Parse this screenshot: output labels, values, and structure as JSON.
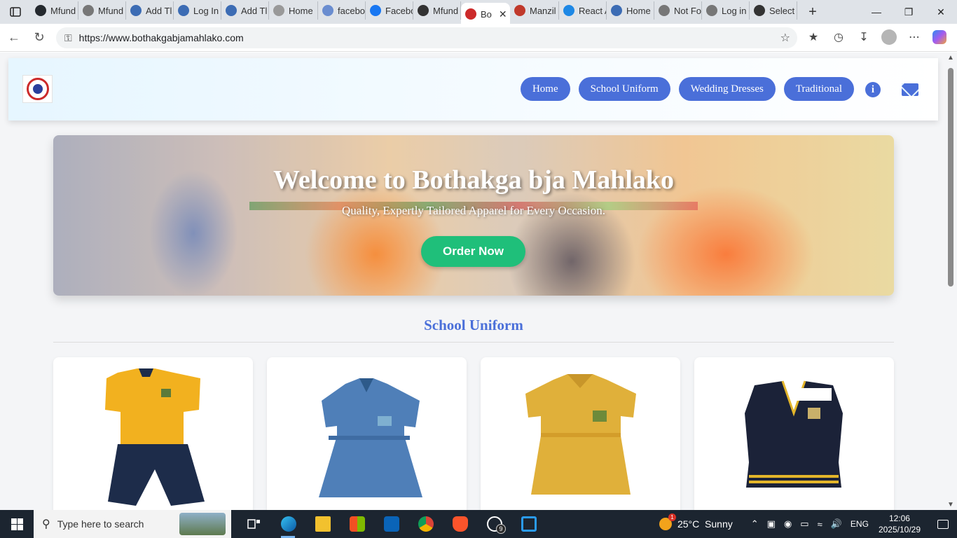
{
  "browser": {
    "tabs": [
      {
        "label": "Mfund",
        "icon": "github-icon",
        "color": "#24292e"
      },
      {
        "label": "Mfund",
        "icon": "globe-icon",
        "color": "#777777"
      },
      {
        "label": "Add Tl",
        "icon": "wordpress-icon",
        "color": "#3c6cb4"
      },
      {
        "label": "Log In",
        "icon": "wordpress-icon",
        "color": "#3c6cb4"
      },
      {
        "label": "Add Tl",
        "icon": "wordpress-icon",
        "color": "#3c6cb4"
      },
      {
        "label": "Home",
        "icon": "page-icon",
        "color": "#999999"
      },
      {
        "label": "facebo",
        "icon": "search-icon",
        "color": "#6a8dd0"
      },
      {
        "label": "Facebo",
        "icon": "facebook-icon",
        "color": "#1877f2"
      },
      {
        "label": "Mfund",
        "icon": "globe-icon",
        "color": "#333333"
      },
      {
        "label": "Bo",
        "icon": "site-logo-icon",
        "color": "#cc2a2a",
        "active": true
      },
      {
        "label": "Manzil",
        "icon": "site-icon",
        "color": "#c0392b"
      },
      {
        "label": "React A",
        "icon": "react-icon",
        "color": "#1e88e5"
      },
      {
        "label": "Home",
        "icon": "wordpress-icon",
        "color": "#3c6cb4"
      },
      {
        "label": "Not Fo",
        "icon": "globe-icon",
        "color": "#777777"
      },
      {
        "label": "Log in",
        "icon": "globe-icon",
        "color": "#777777"
      },
      {
        "label": "Select",
        "icon": "globe-icon",
        "color": "#333333"
      }
    ],
    "url": "https://www.bothakgabjamahlako.com"
  },
  "site": {
    "nav": [
      "Home",
      "School Uniform",
      "Wedding Dresses",
      "Traditional"
    ],
    "hero_title": "Welcome to Bothakga bja Mahlako",
    "hero_subtitle": "Quality, Expertly Tailored Apparel for Every Occasion.",
    "order_button": "Order Now",
    "section_title": "School Uniform",
    "products": [
      {
        "name": "yellow-polo-and-navy-shorts",
        "colors": [
          "#f2b11f",
          "#1d2c4a"
        ]
      },
      {
        "name": "blue-school-dress",
        "colors": [
          "#4f7fb8",
          "#3f6ca3"
        ]
      },
      {
        "name": "yellow-check-dress",
        "colors": [
          "#e0b03a",
          "#d39d2a"
        ]
      },
      {
        "name": "navy-sweater-vest",
        "colors": [
          "#1b2238",
          "#e3b52a"
        ]
      }
    ]
  },
  "taskbar": {
    "search_placeholder": "Type here to search",
    "whatsapp_badge": "9",
    "weather": "25°C  Sunny",
    "weather_badge": "1",
    "language": "ENG",
    "time": "12:06",
    "date": "2025/10/29"
  },
  "colors": {
    "accent": "#4a6fd9",
    "order_button": "#1fbf7a"
  }
}
